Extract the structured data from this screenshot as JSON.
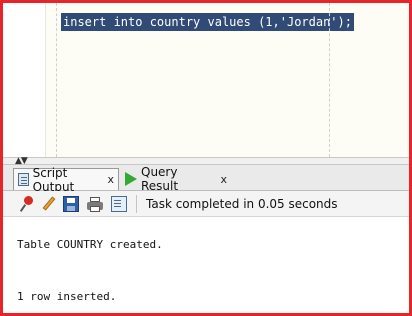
{
  "editor": {
    "code_line": "insert into country values (1,'Jordan');"
  },
  "output_tabs": [
    {
      "label": "Script Output",
      "close": "x",
      "icon": "script-output-icon"
    },
    {
      "label": "Query Result",
      "close": "x",
      "icon": "run-icon"
    }
  ],
  "toolbar": {
    "status_text": "Task completed in 0.05 seconds",
    "icons": [
      "pin-icon",
      "pencil-icon",
      "save-icon",
      "print-icon",
      "script-icon"
    ]
  },
  "output": {
    "lines": [
      "Table COUNTRY created.",
      "1 row inserted."
    ]
  },
  "colors": {
    "selection": "#2f4b76",
    "frame": "#e8232a"
  }
}
